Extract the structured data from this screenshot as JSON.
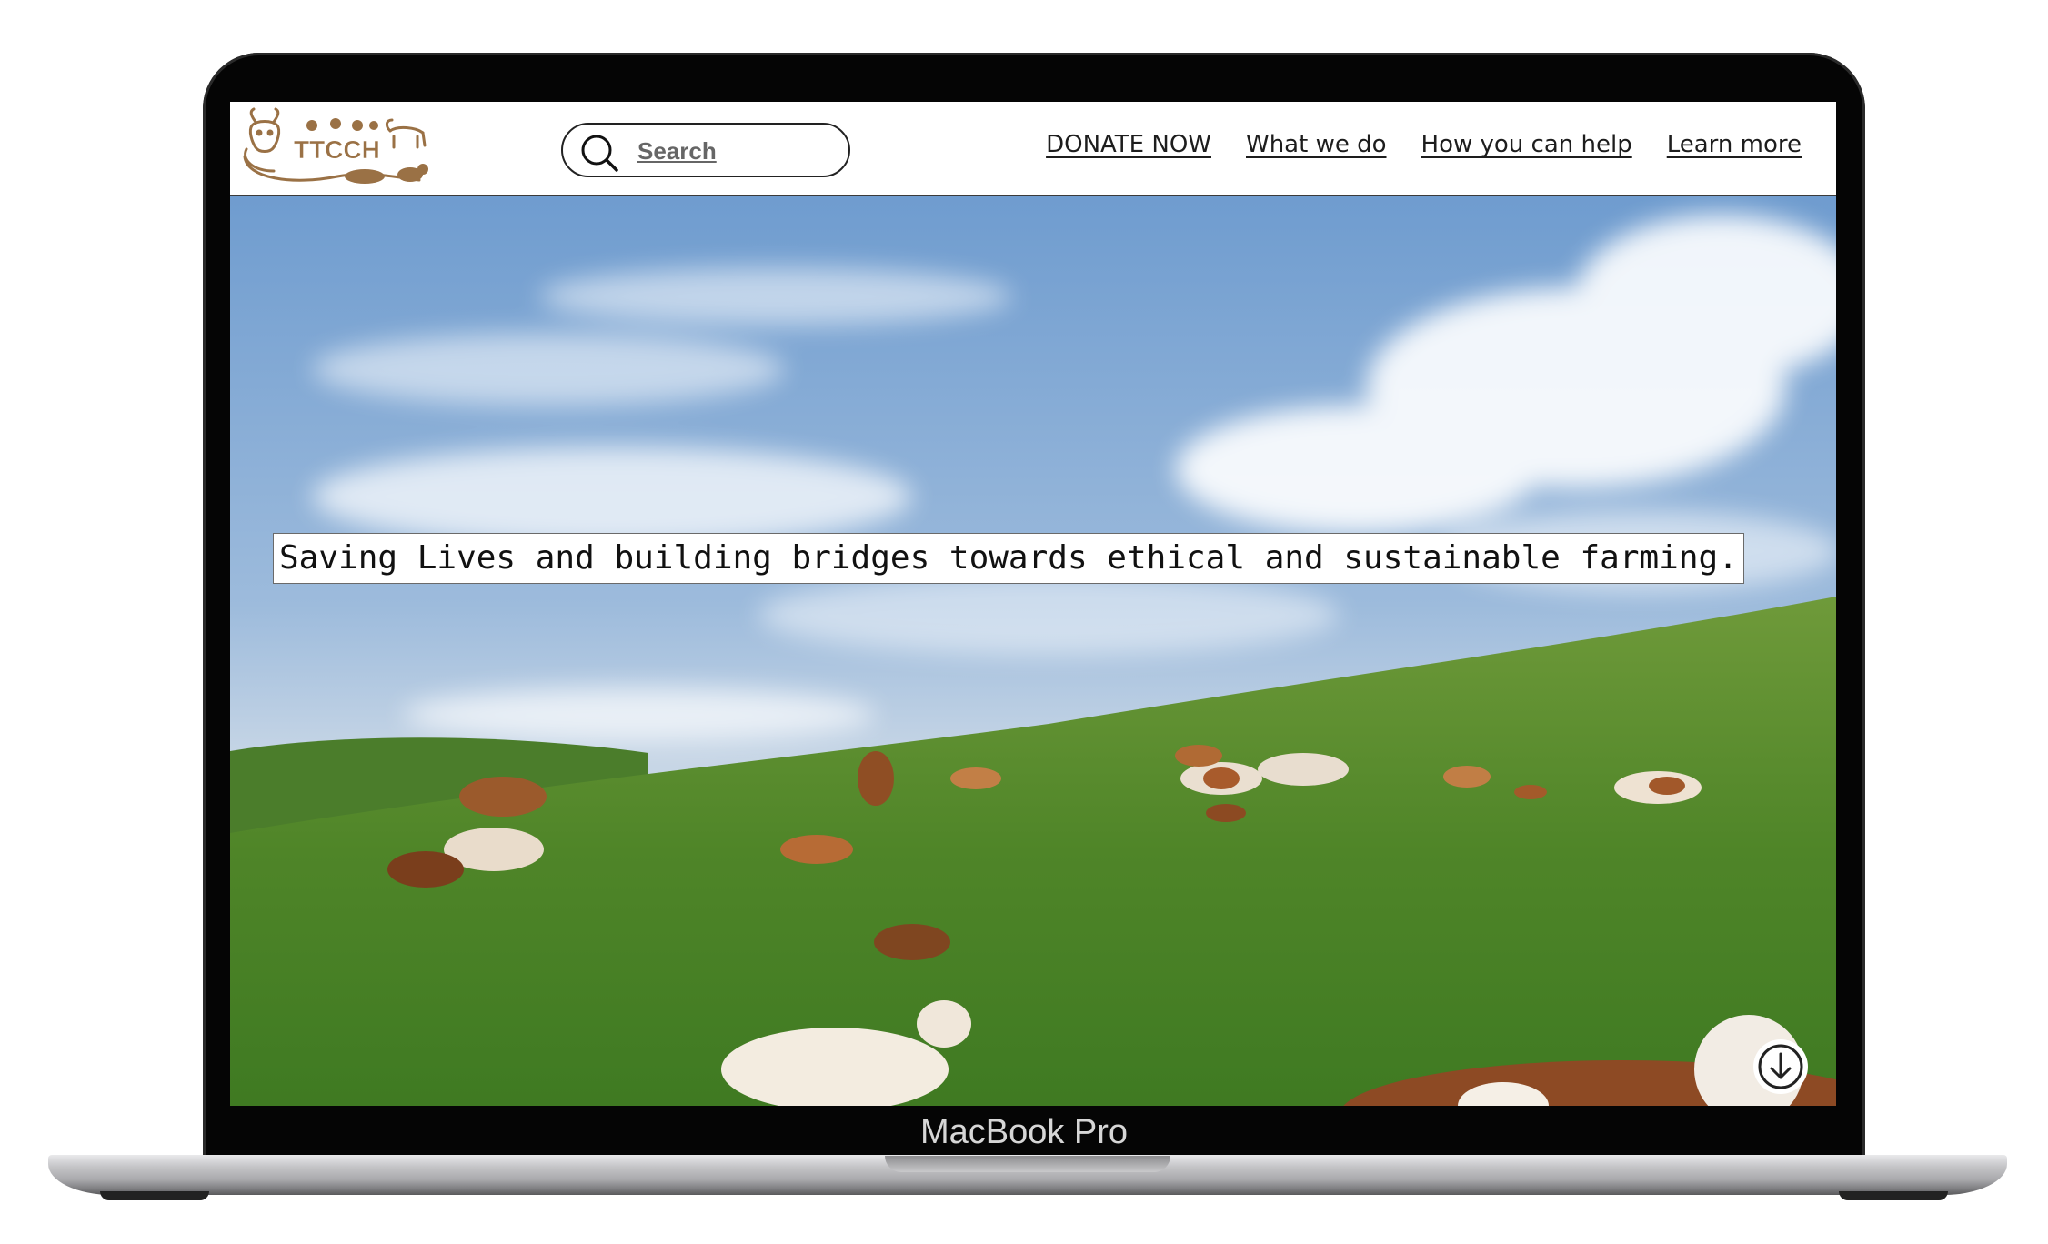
{
  "device": {
    "model_label": "MacBook Pro"
  },
  "header": {
    "logo_text": "TTCCH",
    "search": {
      "placeholder": "Search"
    },
    "nav": [
      {
        "label": "DONATE NOW"
      },
      {
        "label": "What we do"
      },
      {
        "label": "How you can help"
      },
      {
        "label": "Learn more"
      }
    ]
  },
  "hero": {
    "tagline": "Saving Lives and building bridges towards ethical and sustainable farming.",
    "image": "cows-grazing-on-green-hillside",
    "scroll_icon": "arrow-down-icon"
  },
  "colors": {
    "brand": "#9a7145",
    "nav_text": "#1d1d1d",
    "header_border": "#3a3a3a"
  }
}
